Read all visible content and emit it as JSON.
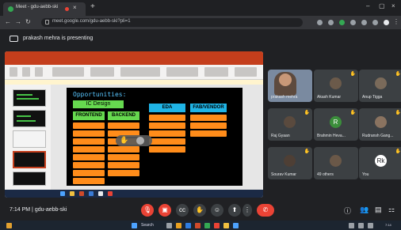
{
  "browser": {
    "tab_title": "Meet - gdu-aebb-ski",
    "url": "meet.google.com/gdu-aebb-ski?pli=1"
  },
  "meet": {
    "presenting_text": "prakash mehra is presenting",
    "meeting_time": "7:14 PM",
    "meeting_separator": "|",
    "meeting_code": "gdu-aebb-ski"
  },
  "slide": {
    "title": "Opportunities:",
    "ic_design_label": "IC Design",
    "columns": [
      {
        "label": "FRONTEND",
        "color": "#66d94f"
      },
      {
        "label": "BACKEND",
        "color": "#66d94f"
      },
      {
        "label": "EDA",
        "color": "#1fb4e6"
      },
      {
        "label": "FAB/VENDOR",
        "color": "#1fb4e6"
      }
    ]
  },
  "participants": [
    {
      "name": "prakash mehra",
      "type": "video"
    },
    {
      "name": "Akash Kumar",
      "type": "avatar",
      "hand": true
    },
    {
      "name": "Anup Tigga",
      "type": "avatar",
      "hand": true
    },
    {
      "name": "Raj Gyaan",
      "type": "avatar",
      "hand": true
    },
    {
      "name": "Brahmin Heva...",
      "type": "letter",
      "letter": "R",
      "color": "#3b8e3b",
      "hand": true
    },
    {
      "name": "Rudransh Gang...",
      "type": "avatar",
      "hand": true
    },
    {
      "name": "Sourav Kumar",
      "type": "avatar",
      "hand": true
    },
    {
      "name": "49 others",
      "type": "avatar",
      "hand": false
    },
    {
      "name": "You",
      "type": "letter",
      "letter": "Rk",
      "color": "#ffffff",
      "hand": true
    }
  ],
  "controls": {
    "mic_icon": "mic-off-icon",
    "camera_icon": "camera-off-icon",
    "captions_icon": "captions-icon",
    "raise_hand_icon": "raise-hand-icon",
    "present_icon": "present-icon",
    "more_icon": "more-icon",
    "end_icon": "end-call-icon",
    "accent_red": "#ea4335"
  },
  "os_taskbar": {
    "search_text": "Search",
    "clock": "7:14"
  }
}
